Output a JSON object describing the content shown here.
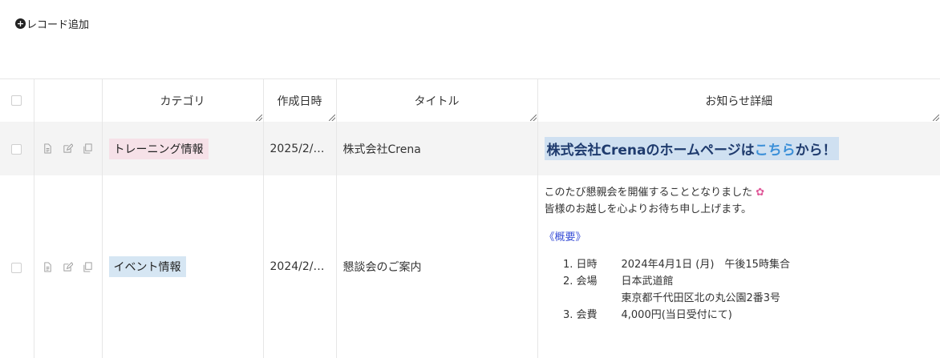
{
  "toolbar": {
    "add_record_label": "レコード追加"
  },
  "columns": {
    "category": "カテゴリ",
    "created": "作成日時",
    "title": "タイトル",
    "detail": "お知らせ詳細"
  },
  "colors": {
    "badge_training": "#f6e1e8",
    "badge_event": "#d6e6f3",
    "headline_bg": "#cfe0f1",
    "link": "#3b8fd8",
    "section_heading": "#3a4fd6"
  },
  "rows": [
    {
      "category": "トレーニング情報",
      "created": "2025/2/…",
      "title": "株式会社Crena",
      "detail": {
        "headline_before": "株式会社Crenaのホームページは",
        "headline_link": "こちら",
        "headline_after": "から！"
      }
    },
    {
      "category": "イベント情報",
      "created": "2024/2/…",
      "title": "懇談会のご案内",
      "detail": {
        "line1": "このたび懇親会を開催することとなりました",
        "line1_icon": "flower-icon",
        "line2": "皆様のお越しを心よりお待ち申し上げます。",
        "section": "《概要》",
        "items": [
          {
            "label": "日時",
            "value": "2024年4月1日 (月)　午後15時集合"
          },
          {
            "label": "会場",
            "value": "日本武道館",
            "value2": "東京都千代田区北の丸公園2番3号"
          },
          {
            "label": "会費",
            "value": "4,000円(当日受付にて)"
          }
        ]
      }
    }
  ]
}
